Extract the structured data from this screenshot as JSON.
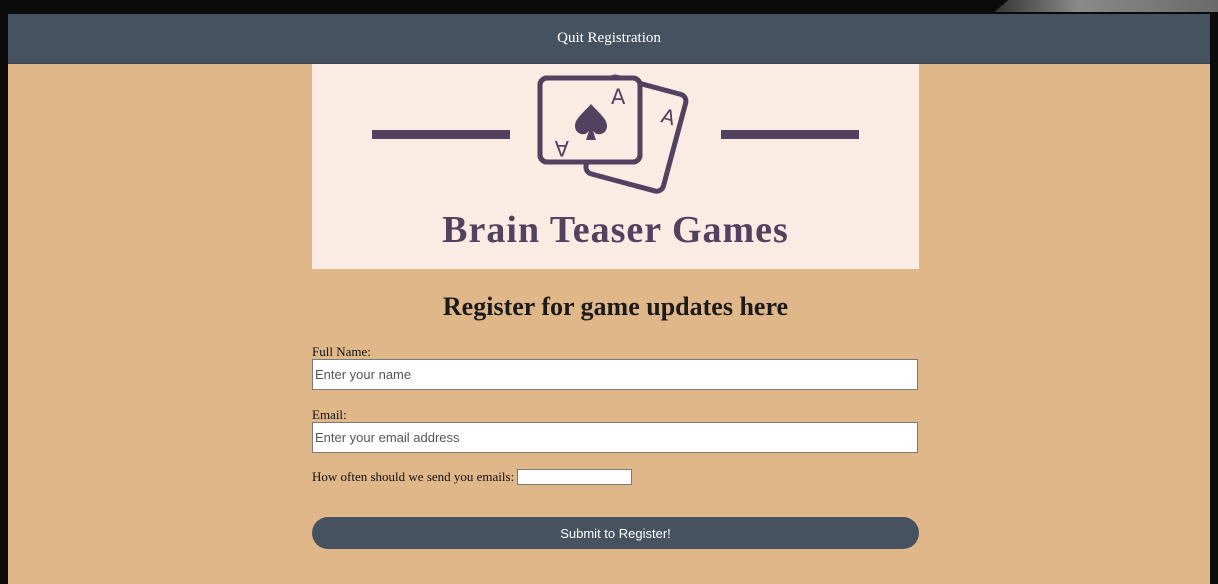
{
  "topbar": {
    "quit_label": "Quit Registration"
  },
  "banner": {
    "brand_name": "Brain Teaser Games",
    "card_letter": "A",
    "icons": [
      "playing-cards-icon",
      "spade-icon"
    ],
    "colors": {
      "background": "#fbece3",
      "ink": "#524260"
    }
  },
  "form": {
    "heading": "Register for game updates here",
    "full_name": {
      "label": "Full Name:",
      "value": "",
      "placeholder": "Enter your name"
    },
    "email": {
      "label": "Email:",
      "value": "",
      "placeholder": "Enter your email address"
    },
    "frequency": {
      "label": "How often should we send you emails:",
      "value": ""
    },
    "submit_label": "Submit to Register!"
  },
  "theme": {
    "page_background": "#dfb789",
    "bar_color": "#465260"
  }
}
